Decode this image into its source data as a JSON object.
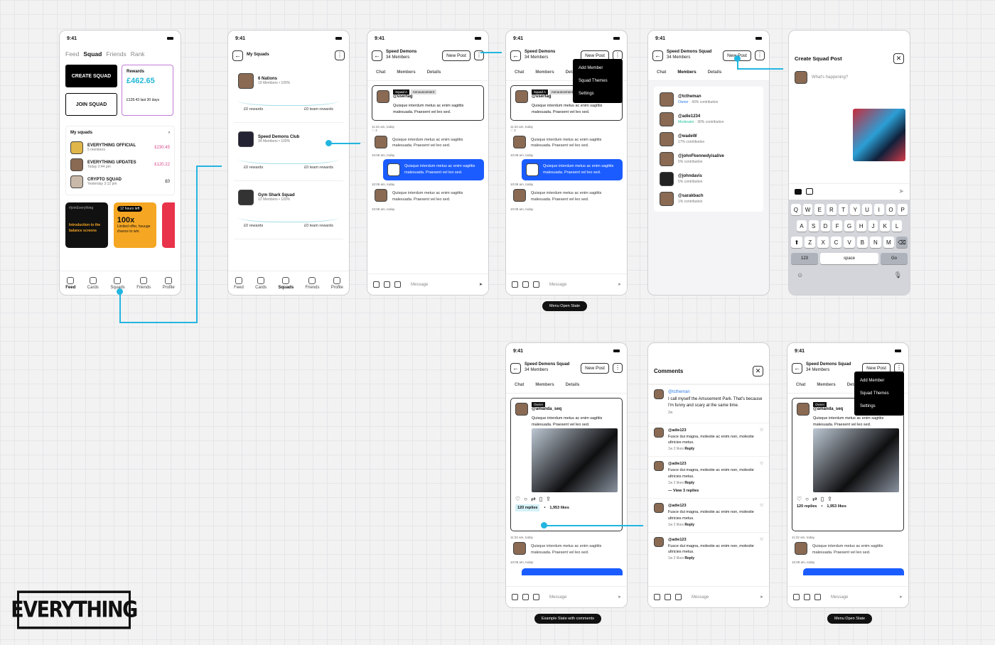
{
  "time": "9:41",
  "brand": "EVERYTHING",
  "feed": {
    "tabs": [
      "Feed",
      "Squad",
      "Friends",
      "Rank"
    ],
    "create": "CREATE SQUAD",
    "join": "JOIN SQUAD",
    "rewards_label": "Rewards",
    "rewards_value": "£462.65",
    "rewards_sub": "£128.43 last 30 days",
    "my_squads": "My squads",
    "squads": [
      {
        "name": "EVERYTHING OFFICIAL",
        "sub": "5 members",
        "value": "£230.45"
      },
      {
        "name": "EVERYTHING UPDATES",
        "sub": "Today 2:44 pm",
        "value": "£120.22"
      },
      {
        "name": "CRYPTO SQUAD",
        "sub": "Yesterday 3:12 pm",
        "value": "£0"
      }
    ],
    "promo1_tag": "#joinEverything",
    "promo1_text": "Introduction to the balance screens",
    "promo2_tag": "12 hours left",
    "promo2_big": "100x",
    "promo2_text": "Limited offer, huuuge chance to win.",
    "nav": [
      "Feed",
      "Cards",
      "Squads",
      "Friends",
      "Profile"
    ]
  },
  "mysq": {
    "title": "My Squads",
    "items": [
      {
        "name": "6 Nations",
        "members": "19 Members",
        "pct": "100%",
        "r1": "£0 rewards",
        "r2": "£0 team rewards"
      },
      {
        "name": "Speed Demons Club",
        "members": "34 Members",
        "pct": "100%",
        "r1": "£0 rewards",
        "r2": "£0 team rewards"
      },
      {
        "name": "Gym Shark Squad",
        "members": "12 Members",
        "pct": "100%",
        "r1": "£0 rewards",
        "r2": "£0 team rewards"
      }
    ]
  },
  "chat": {
    "name": "Speed Demons",
    "members": "34 Members",
    "newpost": "New Post",
    "tabs": [
      "Chat",
      "Members",
      "Details"
    ],
    "tag1": "Squad A",
    "tag2": "Announcement",
    "user": "@usertag",
    "post": "Quisque interdum metus ac enim sagittis malesuada. Praesent vel leo sed.",
    "ts1": "11:32 am, today",
    "likes": "2",
    "msg": "Quisque interdum metus ac enim sagittis malesuada. Praesent vel leo sed.",
    "ts2": "10:08 am, today",
    "ts3": "10:08 am, today",
    "ts4": "10:08 am, today",
    "placeholder": "Message"
  },
  "menu": {
    "items": [
      "Add Member",
      "Squad Themes",
      "Settings"
    ],
    "pill": "Menu Open State"
  },
  "members": {
    "name": "Speed Demons Squad",
    "members": "34 Members",
    "list": [
      {
        "h": "@tctheman",
        "s": "Owner",
        "c": "43% contribution"
      },
      {
        "h": "@adie1234",
        "s": "Moderator",
        "c": "30% contribution"
      },
      {
        "h": "@wadeW",
        "s": "",
        "c": "17% contribution"
      },
      {
        "h": "@johnFkennedyisalive",
        "s": "",
        "c": "5% contribution"
      },
      {
        "h": "@johndavis",
        "s": "",
        "c": "5% contribution"
      },
      {
        "h": "@sarakbach",
        "s": "",
        "c": "1% contribution"
      }
    ]
  },
  "create": {
    "title": "Create Squad Post",
    "placeholder": "What's happening?",
    "rows": [
      [
        "Q",
        "W",
        "E",
        "R",
        "T",
        "Y",
        "U",
        "I",
        "O",
        "P"
      ],
      [
        "A",
        "S",
        "D",
        "F",
        "G",
        "H",
        "J",
        "K",
        "L"
      ],
      [
        "Z",
        "X",
        "C",
        "V",
        "B",
        "N",
        "M"
      ]
    ],
    "k123": "123",
    "space": "space",
    "go": "Go"
  },
  "post2": {
    "owner": "Owner",
    "user": "@amanda_seq",
    "text": "Quisque interdum metus ac enim sagittis malesuada. Praesent vel leo sed.",
    "replies": "120 replies",
    "likes": "1,953 likes",
    "ts1": "11:32 am, today",
    "ts2": "10:08 am, today",
    "pill": "Example State with comments"
  },
  "comments": {
    "title": "Comments",
    "op": "@tctheman",
    "optext": "I call myself the Amusement Park. That's because I'm funny and scary at the same time.",
    "opts": "2w",
    "list": [
      {
        "h": "@adie123",
        "t": "Fusce dui magna, molestie ac enim non, molestie ultricies metus.",
        "m": "1w",
        "l": "2 likes",
        "r": "Reply"
      },
      {
        "h": "@adie123",
        "t": "Fusce dui magna, molestie ac enim non, molestie ultricies metus.",
        "m": "1w",
        "l": "2 likes",
        "r": "Reply"
      },
      {
        "h": "@adie123",
        "t": "Fusce dui magna, molestie ac enim non, molestie ultricies metus.",
        "m": "1w",
        "l": "2 likes",
        "r": "Reply"
      },
      {
        "h": "@adie123",
        "t": "Fusce dui magna, molestie ac enim non, molestie ultricies metus.",
        "m": "1w",
        "l": "2 likes",
        "r": "Reply"
      }
    ],
    "view": "View 3 replies"
  }
}
